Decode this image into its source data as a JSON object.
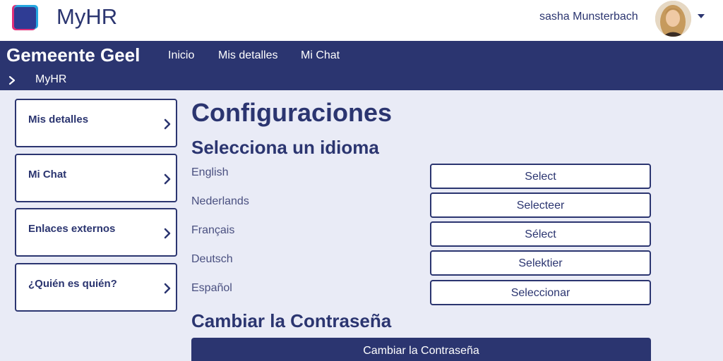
{
  "header": {
    "app_title": "MyHR",
    "user_name": "sasha Munsterbach"
  },
  "nav": {
    "org_name": "Gemeente Geel",
    "links": [
      "Inicio",
      "Mis detalles",
      "Mi Chat"
    ],
    "breadcrumb": "MyHR"
  },
  "sidebar": {
    "items": [
      {
        "label": "Mis detalles"
      },
      {
        "label": "Mi Chat"
      },
      {
        "label": "Enlaces externos"
      },
      {
        "label": "¿Quién es quién?"
      }
    ]
  },
  "main": {
    "title": "Configuraciones",
    "language_heading": "Selecciona un idioma",
    "languages": [
      {
        "name": "English",
        "button": "Select"
      },
      {
        "name": "Nederlands",
        "button": "Selecteer"
      },
      {
        "name": "Français",
        "button": "Sélect"
      },
      {
        "name": "Deutsch",
        "button": "Selektier"
      },
      {
        "name": "Español",
        "button": "Seleccionar"
      }
    ],
    "password_heading": "Cambiar la Contraseña",
    "password_button": "Cambiar la Contraseña"
  },
  "colors": {
    "primary": "#2b3570",
    "background": "#e9ebf6"
  }
}
